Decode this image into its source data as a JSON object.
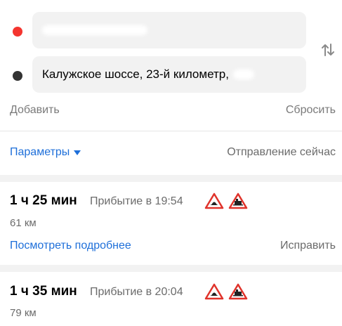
{
  "route_inputs": {
    "from_value": "",
    "to_value": "Калужское шоссе, 23-й километр,"
  },
  "actions": {
    "add_label": "Добавить",
    "reset_label": "Сбросить"
  },
  "parameters": {
    "label": "Параметры",
    "departure_label": "Отправление сейчас"
  },
  "routes": [
    {
      "duration": "1 ч 25 мин",
      "arrival": "Прибытие в 19:54",
      "distance": "61 км",
      "details_label": "Посмотреть подробнее",
      "fix_label": "Исправить",
      "signs": [
        "speed-bump-warning-icon",
        "railway-crossing-warning-icon"
      ]
    },
    {
      "duration": "1 ч 35 мин",
      "arrival": "Прибытие в 20:04",
      "distance": "79 км",
      "signs": [
        "speed-bump-warning-icon",
        "railway-crossing-warning-icon"
      ]
    }
  ],
  "colors": {
    "start_marker": "#f4352f",
    "end_marker": "#333333",
    "link_blue": "#1e6fd9",
    "sign_red": "#e0332b"
  }
}
